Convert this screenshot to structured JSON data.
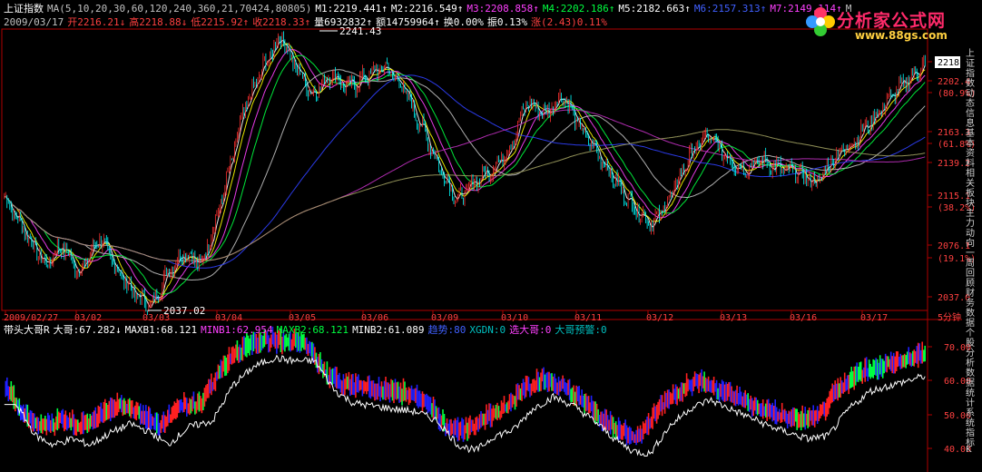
{
  "header": {
    "line1": [
      {
        "text": "上证指数",
        "color": "#ffffff"
      },
      {
        "text": "MA(5,10,20,30,60,120,240,360,21,70424,80805)",
        "color": "#c0c0c0"
      },
      {
        "text": "M1:2219.441↑",
        "color": "#ffffff"
      },
      {
        "text": "M2:2216.549↑",
        "color": "#ffffff"
      },
      {
        "text": "M3:2208.858↑",
        "color": "#ff40ff"
      },
      {
        "text": "M4:2202.186↑",
        "color": "#00ff40"
      },
      {
        "text": "M5:2182.663↑",
        "color": "#ffffff"
      },
      {
        "text": "M6:2157.313↑",
        "color": "#4060ff"
      },
      {
        "text": "M7:2149.114↑",
        "color": "#ff40ff"
      },
      {
        "text": "M",
        "color": "#c0c0c0"
      }
    ],
    "line2": [
      {
        "text": "2009/03/17",
        "color": "#c0c0c0"
      },
      {
        "text": "开2216.21↓",
        "color": "#ff4040"
      },
      {
        "text": "高2218.88↓",
        "color": "#ff4040"
      },
      {
        "text": "低2215.92↑",
        "color": "#ff4040"
      },
      {
        "text": "收2218.33↑",
        "color": "#ff4040"
      },
      {
        "text": "量6932832↑",
        "color": "#ffffff"
      },
      {
        "text": "额14759964↑",
        "color": "#ffffff"
      },
      {
        "text": "换0.00%",
        "color": "#ffffff"
      },
      {
        "text": "振0.13%",
        "color": "#ffffff"
      },
      {
        "text": "涨(2.43)0.11%",
        "color": "#ff4040"
      }
    ],
    "line3": [
      {
        "text": "带头大哥R",
        "color": "#ffffff"
      },
      {
        "text": "大哥:67.282↓",
        "color": "#ffffff"
      },
      {
        "text": "MAXB1:68.121",
        "color": "#ffffff"
      },
      {
        "text": "MINB1:62.954",
        "color": "#ff40ff"
      },
      {
        "text": "MAXB2:68.121",
        "color": "#00ff40"
      },
      {
        "text": "MINB2:61.089",
        "color": "#ffffff"
      },
      {
        "text": "趋势:80",
        "color": "#4060ff"
      },
      {
        "text": "XGDN:0",
        "color": "#00c0c0"
      },
      {
        "text": "选大哥:0",
        "color": "#ff40ff"
      },
      {
        "text": "大哥预警:0",
        "color": "#00c0c0"
      }
    ]
  },
  "logo": {
    "title": "分析家公式网",
    "url": "www.88gs.com"
  },
  "right_strip_chars": [
    "上",
    "证",
    "指",
    "数",
    "动",
    "态",
    "信",
    "息",
    "基",
    "本",
    "资",
    "料",
    "相",
    "关",
    "板",
    "块",
    "主",
    "力",
    "动",
    "向",
    "一",
    "周",
    "回",
    "顾",
    "财",
    "务",
    "数",
    "据",
    "个",
    "股",
    "分",
    "析",
    "数",
    "据",
    "统",
    "计",
    "系",
    "统",
    "指",
    "标",
    "K"
  ],
  "chart_data": [
    {
      "type": "candlestick",
      "title": "上证指数",
      "timeframe": "5分钟",
      "ylim": [
        2037.0,
        2241.43
      ],
      "y_ticks": [
        "2218.3",
        "2202.4",
        "(80.9%)",
        "2163.3",
        "(61.8%)",
        "2139.2",
        "2115.1",
        "(38.2%)",
        "2076.1",
        "(19.1%)",
        "2037.0"
      ],
      "x_ticks": [
        "2009/02/27",
        "03/02",
        "03/03",
        "03/04",
        "03/05",
        "03/06",
        "03/09",
        "03/10",
        "03/11",
        "03/12",
        "03/13",
        "03/16",
        "03/17"
      ],
      "annotations": [
        {
          "label": "2241.43",
          "kind": "high"
        },
        {
          "label": "2037.02",
          "kind": "low"
        }
      ],
      "last_price_label": "2218.3",
      "close_anchors": [
        [
          0,
          2120
        ],
        [
          18,
          2090
        ],
        [
          30,
          2070
        ],
        [
          42,
          2085
        ],
        [
          55,
          2065
        ],
        [
          70,
          2090
        ],
        [
          82,
          2068
        ],
        [
          95,
          2050
        ],
        [
          108,
          2040
        ],
        [
          120,
          2065
        ],
        [
          132,
          2080
        ],
        [
          145,
          2070
        ],
        [
          160,
          2120
        ],
        [
          175,
          2180
        ],
        [
          190,
          2215
        ],
        [
          203,
          2238
        ],
        [
          214,
          2215
        ],
        [
          226,
          2195
        ],
        [
          240,
          2210
        ],
        [
          252,
          2200
        ],
        [
          266,
          2208
        ],
        [
          280,
          2215
        ],
        [
          293,
          2200
        ],
        [
          307,
          2170
        ],
        [
          320,
          2140
        ],
        [
          333,
          2118
        ],
        [
          346,
          2132
        ],
        [
          358,
          2140
        ],
        [
          371,
          2155
        ],
        [
          384,
          2190
        ],
        [
          397,
          2180
        ],
        [
          410,
          2195
        ],
        [
          423,
          2170
        ],
        [
          437,
          2150
        ],
        [
          450,
          2130
        ],
        [
          463,
          2112
        ],
        [
          476,
          2100
        ],
        [
          489,
          2120
        ],
        [
          503,
          2150
        ],
        [
          516,
          2165
        ],
        [
          530,
          2150
        ],
        [
          543,
          2140
        ],
        [
          556,
          2147
        ],
        [
          570,
          2140
        ],
        [
          583,
          2138
        ],
        [
          596,
          2130
        ],
        [
          610,
          2150
        ],
        [
          623,
          2160
        ],
        [
          636,
          2175
        ],
        [
          650,
          2192
        ],
        [
          663,
          2205
        ],
        [
          676,
          2218
        ]
      ],
      "series": [
        {
          "name": "M1",
          "period": 5,
          "color": "#ffffff"
        },
        {
          "name": "M2",
          "period": 10,
          "color": "#ffff00"
        },
        {
          "name": "M3",
          "period": 20,
          "color": "#ff40ff"
        },
        {
          "name": "M4",
          "period": 30,
          "color": "#00ff40"
        },
        {
          "name": "M5",
          "period": 60,
          "color": "#c0c0c0"
        },
        {
          "name": "M6",
          "period": 120,
          "color": "#3040ff"
        },
        {
          "name": "M7",
          "period": 240,
          "color": "#c030c0"
        },
        {
          "name": "",
          "period": 360,
          "color": "#a0a060"
        }
      ]
    },
    {
      "type": "area",
      "title": "带头大哥R",
      "ylim": [
        35,
        75
      ],
      "y_ticks": [
        "70.00",
        "60.00",
        "50.00",
        "40.00"
      ],
      "value_anchors": [
        [
          0,
          58
        ],
        [
          15,
          47
        ],
        [
          28,
          44
        ],
        [
          42,
          46
        ],
        [
          55,
          44
        ],
        [
          70,
          48
        ],
        [
          85,
          51
        ],
        [
          100,
          48
        ],
        [
          112,
          44
        ],
        [
          128,
          50
        ],
        [
          145,
          52
        ],
        [
          160,
          64
        ],
        [
          175,
          70
        ],
        [
          190,
          73
        ],
        [
          205,
          72
        ],
        [
          220,
          72
        ],
        [
          235,
          62
        ],
        [
          248,
          58
        ],
        [
          262,
          57
        ],
        [
          278,
          56
        ],
        [
          295,
          55
        ],
        [
          310,
          52
        ],
        [
          325,
          44
        ],
        [
          338,
          42
        ],
        [
          352,
          47
        ],
        [
          366,
          49
        ],
        [
          380,
          56
        ],
        [
          395,
          60
        ],
        [
          410,
          57
        ],
        [
          425,
          52
        ],
        [
          440,
          46
        ],
        [
          453,
          42
        ],
        [
          466,
          41
        ],
        [
          480,
          50
        ],
        [
          495,
          56
        ],
        [
          510,
          59
        ],
        [
          525,
          56
        ],
        [
          540,
          53
        ],
        [
          555,
          50
        ],
        [
          568,
          48
        ],
        [
          582,
          46
        ],
        [
          597,
          47
        ],
        [
          612,
          56
        ],
        [
          628,
          62
        ],
        [
          644,
          64
        ],
        [
          660,
          66
        ],
        [
          676,
          68
        ]
      ],
      "colors": {
        "up": "#ff2020",
        "down": "#2020ff",
        "up_fill": "#00ff40",
        "line": "#ffffff"
      }
    }
  ]
}
